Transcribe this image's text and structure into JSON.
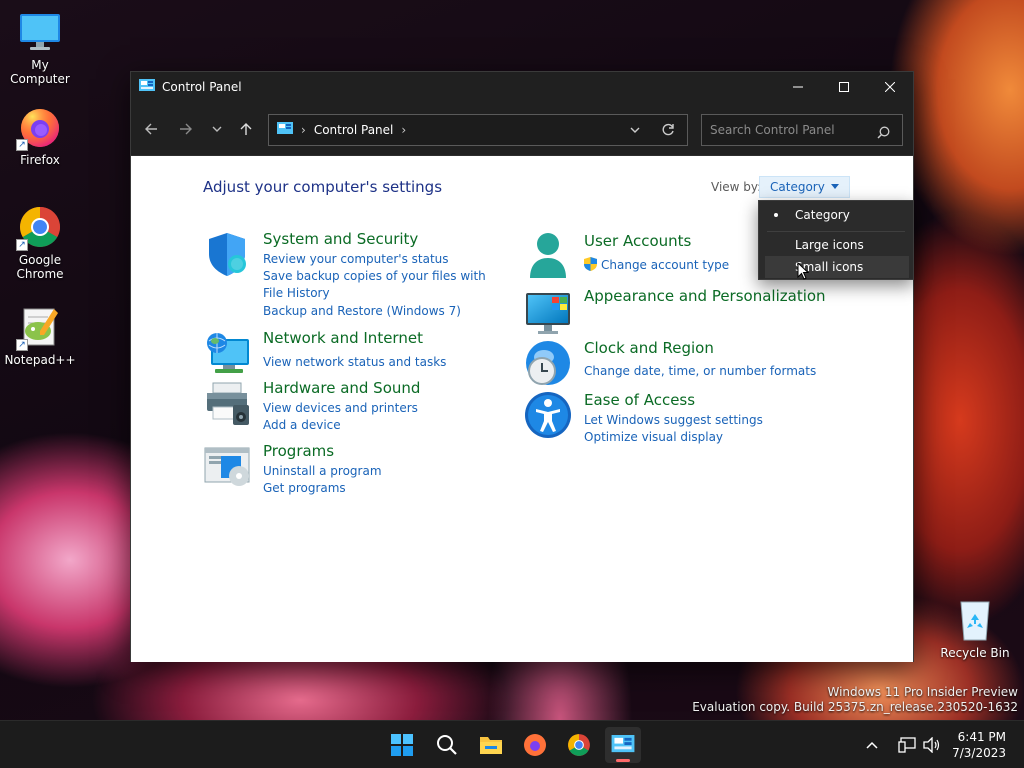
{
  "desktop": {
    "icons": [
      {
        "label": "My Computer"
      },
      {
        "label": "Firefox"
      },
      {
        "label": "Google Chrome"
      },
      {
        "label": "Notepad++"
      },
      {
        "label": "Recycle Bin"
      }
    ]
  },
  "window": {
    "title": "Control Panel",
    "address": {
      "segment": "Control Panel"
    },
    "search": {
      "placeholder": "Search Control Panel"
    }
  },
  "content": {
    "page_title": "Adjust your computer's settings",
    "view_by_label": "View by:",
    "view_by_value": "Category",
    "categories": [
      {
        "title": "System and Security",
        "links": [
          "Review your computer's status",
          "Save backup copies of your files with File History",
          "Backup and Restore (Windows 7)"
        ]
      },
      {
        "title": "Network and Internet",
        "links": [
          "View network status and tasks"
        ]
      },
      {
        "title": "Hardware and Sound",
        "links": [
          "View devices and printers",
          "Add a device"
        ]
      },
      {
        "title": "Programs",
        "links": [
          "Uninstall a program",
          "Get programs"
        ]
      },
      {
        "title": "User Accounts",
        "links": [
          "Change account type"
        ]
      },
      {
        "title": "Appearance and Personalization",
        "links": []
      },
      {
        "title": "Clock and Region",
        "links": [
          "Change date, time, or number formats"
        ]
      },
      {
        "title": "Ease of Access",
        "links": [
          "Let Windows suggest settings",
          "Optimize visual display"
        ]
      }
    ]
  },
  "dropdown": {
    "items": [
      {
        "label": "Category",
        "selected": true
      },
      {
        "label": "Large icons",
        "selected": false
      },
      {
        "label": "Small icons",
        "selected": false,
        "hovered": true
      }
    ]
  },
  "watermark": {
    "line1": "Windows 11 Pro Insider Preview",
    "line2": "Evaluation copy. Build 25375.zn_release.230520-1632"
  },
  "taskbar": {
    "time": "6:41 PM",
    "date": "7/3/2023"
  }
}
